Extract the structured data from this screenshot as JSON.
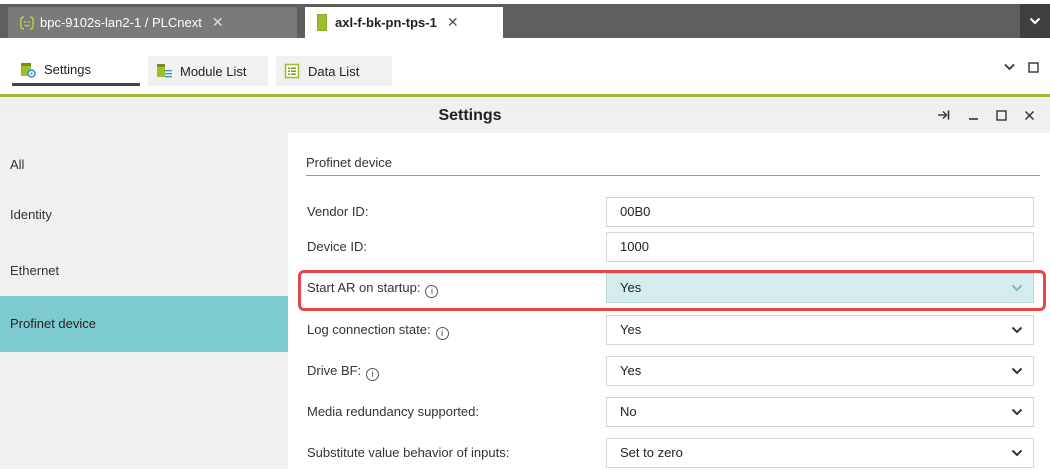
{
  "document_tabs": [
    {
      "label": "bpc-9102s-lan2-1 / PLCnext",
      "close": "✕"
    },
    {
      "label": "axl-f-bk-pn-tps-1",
      "close": "✕"
    }
  ],
  "view_tabs": [
    {
      "label": "Settings"
    },
    {
      "label": "Module List"
    },
    {
      "label": "Data List"
    }
  ],
  "panel": {
    "title": "Settings"
  },
  "sidenav": {
    "items": [
      {
        "label": "All"
      },
      {
        "label": "Identity"
      },
      {
        "label": "Ethernet"
      },
      {
        "label": "Profinet device",
        "selected": true
      }
    ]
  },
  "form": {
    "section": "Profinet device",
    "rows": [
      {
        "label": "Vendor ID:",
        "value": "00B0",
        "type": "text"
      },
      {
        "label": "Device ID:",
        "value": "1000",
        "type": "text"
      },
      {
        "label": "Start AR on startup:",
        "info": "i",
        "value": "Yes",
        "type": "select",
        "highlighted": true
      },
      {
        "label": "Log connection state:",
        "info": "i",
        "value": "Yes",
        "type": "select"
      },
      {
        "label": "Drive BF:",
        "info": "i",
        "value": "Yes",
        "type": "select"
      },
      {
        "label": "Media redundancy supported:",
        "value": "No",
        "type": "select"
      },
      {
        "label": "Substitute value behavior of inputs:",
        "value": "Set to zero",
        "type": "select"
      }
    ]
  },
  "colors": {
    "accent_green": "#9abf2a",
    "selected_nav": "#7dcbd1",
    "highlight_field": "#d4ecee",
    "callout_red": "#e4474a",
    "tab_strip": "#5e5e5e"
  },
  "icons": {
    "plc_tab": "plc-device-icon",
    "bk_tab": "bus-coupler-icon",
    "settings_view": "settings-gear-icon",
    "module_list_view": "module-list-icon",
    "data_list_view": "data-list-icon",
    "info": "info-icon",
    "dropdown": "chevron-down-icon"
  }
}
